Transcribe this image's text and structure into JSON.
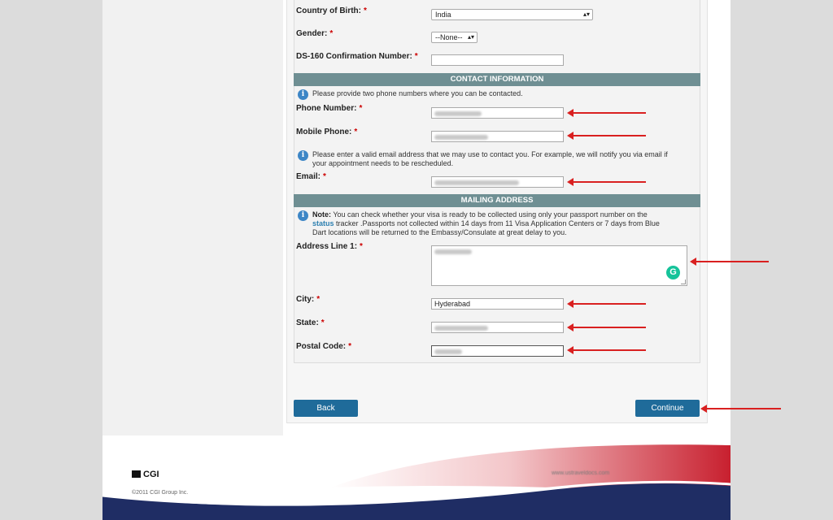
{
  "form": {
    "country_of_birth": {
      "label": "Country of Birth:",
      "required": "*",
      "value": "India"
    },
    "gender": {
      "label": "Gender:",
      "required": "*",
      "value": "--None--"
    },
    "ds160": {
      "label": "DS-160 Confirmation Number:",
      "required": "*",
      "value": ""
    }
  },
  "contact": {
    "header": "CONTACT INFORMATION",
    "info_text": "Please provide two phone numbers where you can be contacted.",
    "phone": {
      "label": "Phone Number:",
      "required": "*"
    },
    "mobile": {
      "label": "Mobile Phone:",
      "required": "*"
    },
    "email_info_line1": "Please enter a valid email address that we may use to contact you. For example, we will notify you via email if",
    "email_info_line2": "your appointment needs to be rescheduled.",
    "email": {
      "label": "Email:",
      "required": "*"
    }
  },
  "mailing": {
    "header": "MAILING ADDRESS",
    "note_bold": "Note:",
    "note_line1": "You can check whether your visa is ready to be collected using only your passport number on the",
    "note_link": "status",
    "note_line2_rest": "tracker .Passports not collected within 14 days from 11 Visa Application Centers or 7 days from Blue",
    "note_line3": "Dart locations will be returned to the Embassy/Consulate at great delay to you.",
    "address1": {
      "label": "Address Line 1:",
      "required": "*"
    },
    "city": {
      "label": "City:",
      "required": "*",
      "value": "Hyderabad"
    },
    "state": {
      "label": "State:",
      "required": "*"
    },
    "postal": {
      "label": "Postal Code:",
      "required": "*"
    }
  },
  "buttons": {
    "back": "Back",
    "continue": "Continue"
  },
  "footer": {
    "logo_text": "CGI",
    "copyright": "©2011 CGI Group Inc.",
    "site": "www.ustraveldocs.com"
  },
  "colors": {
    "section_header": "#6f8f93",
    "button": "#1f6b9a",
    "arrow": "#d92020",
    "footer_red": "#c8202f",
    "footer_navy": "#1f2d64"
  },
  "icons": {
    "info": "info-icon",
    "grammarly": "grammarly-icon",
    "select_caret": "chevron-down-icon"
  }
}
